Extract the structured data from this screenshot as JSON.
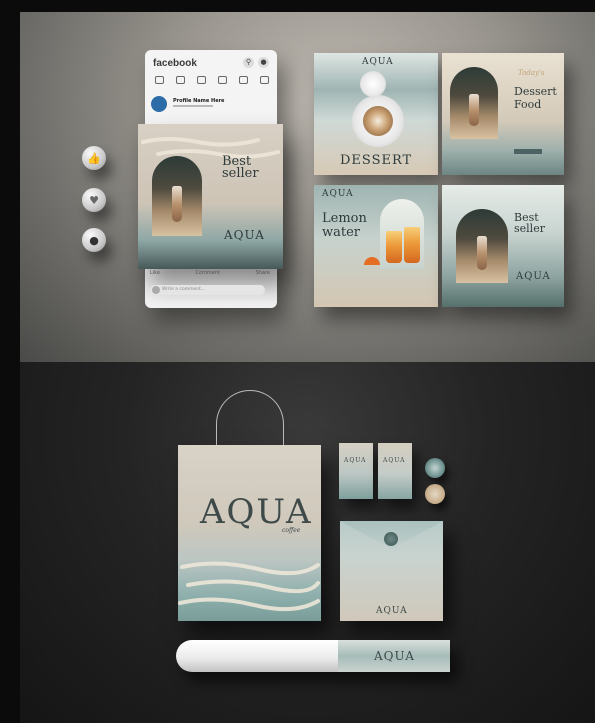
{
  "facebook": {
    "logo": "facebook",
    "page_name": "Profile Name Here",
    "actions": [
      "Like",
      "Comment",
      "Share"
    ],
    "comment_placeholder": "Write a comment..."
  },
  "post": {
    "headline": "Best seller",
    "brand": "AQUA"
  },
  "cards": {
    "dessert": {
      "brand": "AQUA",
      "title": "DESSERT"
    },
    "dessert_food": {
      "kicker": "Today's",
      "title_line1": "Dessert",
      "title_line2": "Food"
    },
    "lemon": {
      "brand": "AQUA",
      "title_line1": "Lemon",
      "title_line2": "water"
    },
    "best": {
      "headline_line1": "Best",
      "headline_line2": "seller",
      "brand": "AQUA"
    }
  },
  "stationery": {
    "bag_logo": "AQUA",
    "bag_sub": "coffee",
    "bizcard_logo": "AQUA",
    "envelope_logo": "AQUA",
    "roll_logo": "AQUA"
  },
  "icons": {
    "reactions": [
      "thumbs-up-icon",
      "heart-icon",
      "wow-icon"
    ]
  }
}
